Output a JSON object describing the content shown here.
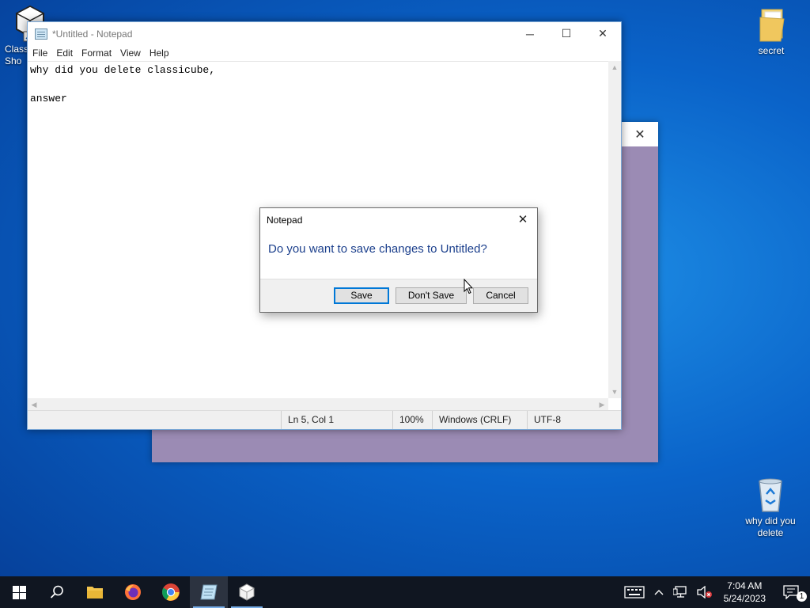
{
  "desktop": {
    "icons": [
      {
        "label": "Class\nSho",
        "icon": "classicube-shortcut-icon"
      },
      {
        "label": "secret",
        "icon": "folder-icon"
      },
      {
        "label": "why did you delete",
        "icon": "recycle-bin-icon"
      }
    ]
  },
  "background_window": {
    "close_symbol": "✕",
    "color": "#9b8bb4"
  },
  "notepad": {
    "title": "*Untitled - Notepad",
    "controls": {
      "minimize": "─",
      "maximize": "☐",
      "close": "✕"
    },
    "menu": [
      "File",
      "Edit",
      "Format",
      "View",
      "Help"
    ],
    "content": "why did you delete classicube,\n\nanswer",
    "status": {
      "position": "Ln 5, Col 1",
      "zoom": "100%",
      "line_ending": "Windows (CRLF)",
      "encoding": "UTF-8"
    }
  },
  "dialog": {
    "title": "Notepad",
    "close_symbol": "✕",
    "message": "Do you want to save changes to Untitled?",
    "buttons": {
      "save": "Save",
      "dont_save": "Don't Save",
      "cancel": "Cancel"
    },
    "accent": "#0078d7"
  },
  "taskbar": {
    "apps": [
      {
        "name": "start",
        "icon": "windows-start-icon"
      },
      {
        "name": "search",
        "icon": "search-icon"
      },
      {
        "name": "file-explorer",
        "icon": "folder-icon"
      },
      {
        "name": "firefox",
        "icon": "firefox-icon"
      },
      {
        "name": "chrome",
        "icon": "chrome-icon"
      },
      {
        "name": "notepad",
        "icon": "notepad-icon",
        "active": true
      },
      {
        "name": "classicube",
        "icon": "classicube-icon"
      }
    ],
    "time": "7:04 AM",
    "date": "5/24/2023",
    "notification_count": "1"
  }
}
